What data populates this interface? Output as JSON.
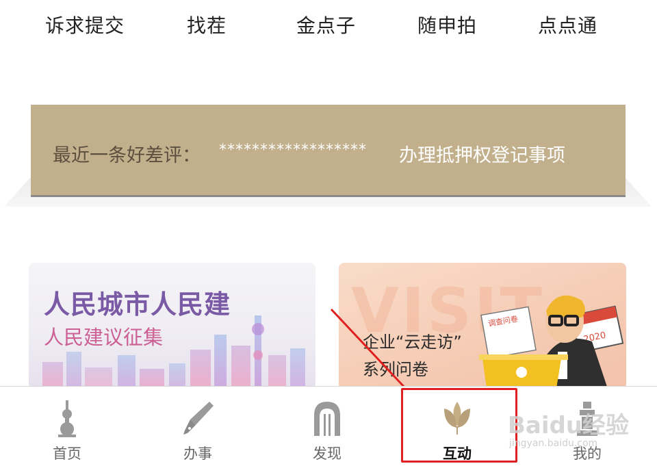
{
  "services": {
    "items": [
      {
        "label": "诉求提交"
      },
      {
        "label": "找茬"
      },
      {
        "label": "金点子"
      },
      {
        "label": "随申拍"
      },
      {
        "label": "点点通"
      }
    ]
  },
  "review_banner": {
    "prefix": "最近一条好差评：",
    "masked": "******************",
    "text": "办理抵押权登记事项",
    "bg_color": "#c2b08d"
  },
  "cards": {
    "left": {
      "title": "人民城市人民建",
      "subtitle": "人民建议征集"
    },
    "right": {
      "watermark": "VISIT",
      "title": "企业“云走访”",
      "subtitle": "系列问卷",
      "sign_text": "调查问卷",
      "calendar_year": "2020"
    }
  },
  "bottom_nav": {
    "active_index": 3,
    "items": [
      {
        "label": "首页",
        "icon": "oriental-pearl-tower-icon"
      },
      {
        "label": "办事",
        "icon": "fountain-pen-icon"
      },
      {
        "label": "发现",
        "icon": "arch-gate-icon"
      },
      {
        "label": "互动",
        "icon": "magnolia-flower-icon"
      },
      {
        "label": "我的",
        "icon": "tower-icon"
      }
    ]
  },
  "watermark": {
    "main": "Baidu经验",
    "sub": "jingyan.baidu.com"
  },
  "colors": {
    "accent_gold": "#b8a07a",
    "highlight_red": "#e02020"
  }
}
